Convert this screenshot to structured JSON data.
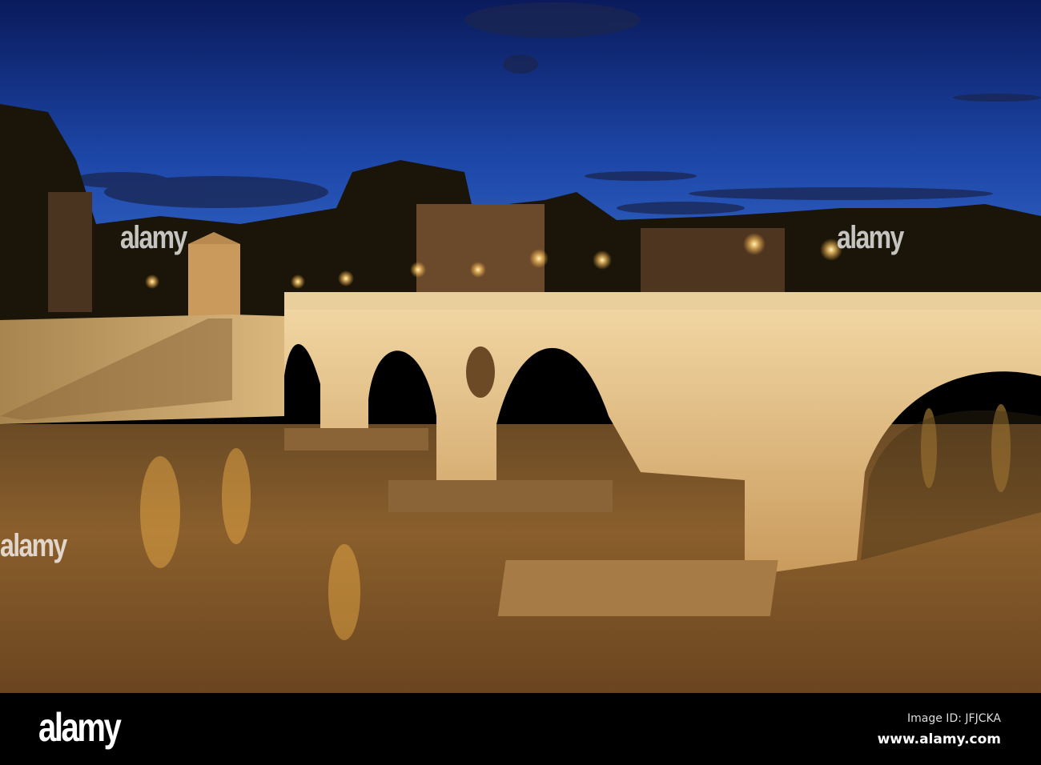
{
  "watermark": {
    "logo_text": "alamy",
    "image_id": "Image ID: JFJCKA",
    "website": "www.alamy.com"
  },
  "colors": {
    "sky_top": "#0a1f6b",
    "sky_horizon": "#2f64c8",
    "river": "#7a5324",
    "stone_lit": "#e8c48a",
    "lamp": "#ffd98a"
  }
}
